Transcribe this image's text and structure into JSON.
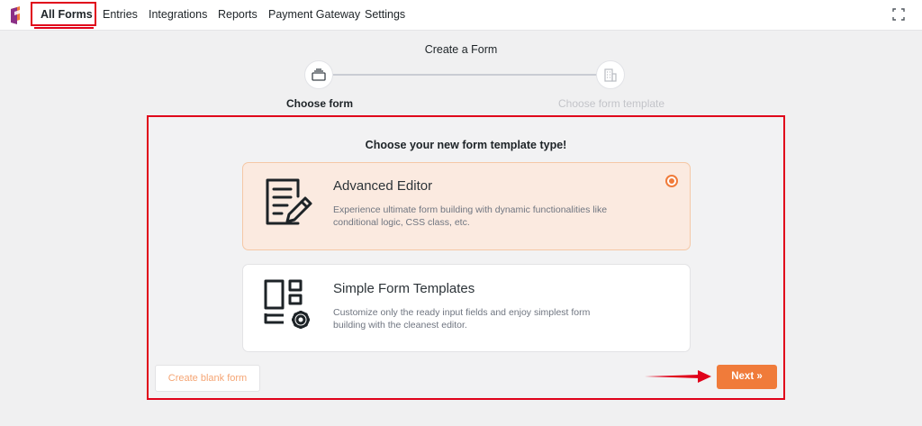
{
  "nav": {
    "items": [
      {
        "label": "All Forms",
        "active": true
      },
      {
        "label": "Entries"
      },
      {
        "label": "Integrations"
      },
      {
        "label": "Reports"
      },
      {
        "label": "Payment Gateway"
      },
      {
        "label": "Settings"
      }
    ],
    "fullscreen_icon": "fullscreen-icon"
  },
  "stepper": {
    "title": "Create a Form",
    "steps": [
      {
        "label": "Choose form",
        "icon": "form-stack-icon",
        "state": "active"
      },
      {
        "label": "Choose form template",
        "icon": "building-icon",
        "state": "inactive"
      }
    ]
  },
  "panel": {
    "heading": "Choose your new form template type!",
    "options": [
      {
        "title": "Advanced Editor",
        "description": "Experience ultimate form building with dynamic functionalities like conditional logic, CSS class, etc.",
        "icon": "document-edit-icon",
        "selected": true
      },
      {
        "title": "Simple Form Templates",
        "description": "Customize only the ready input fields and enjoy simplest form building with the cleanest editor.",
        "icon": "template-settings-icon",
        "selected": false
      }
    ],
    "blank_button": "Create blank form",
    "next_button": "Next »"
  },
  "colors": {
    "accent": "#f07b3a",
    "annotation": "#e0021a",
    "selected_card_bg": "#fbeae0"
  }
}
